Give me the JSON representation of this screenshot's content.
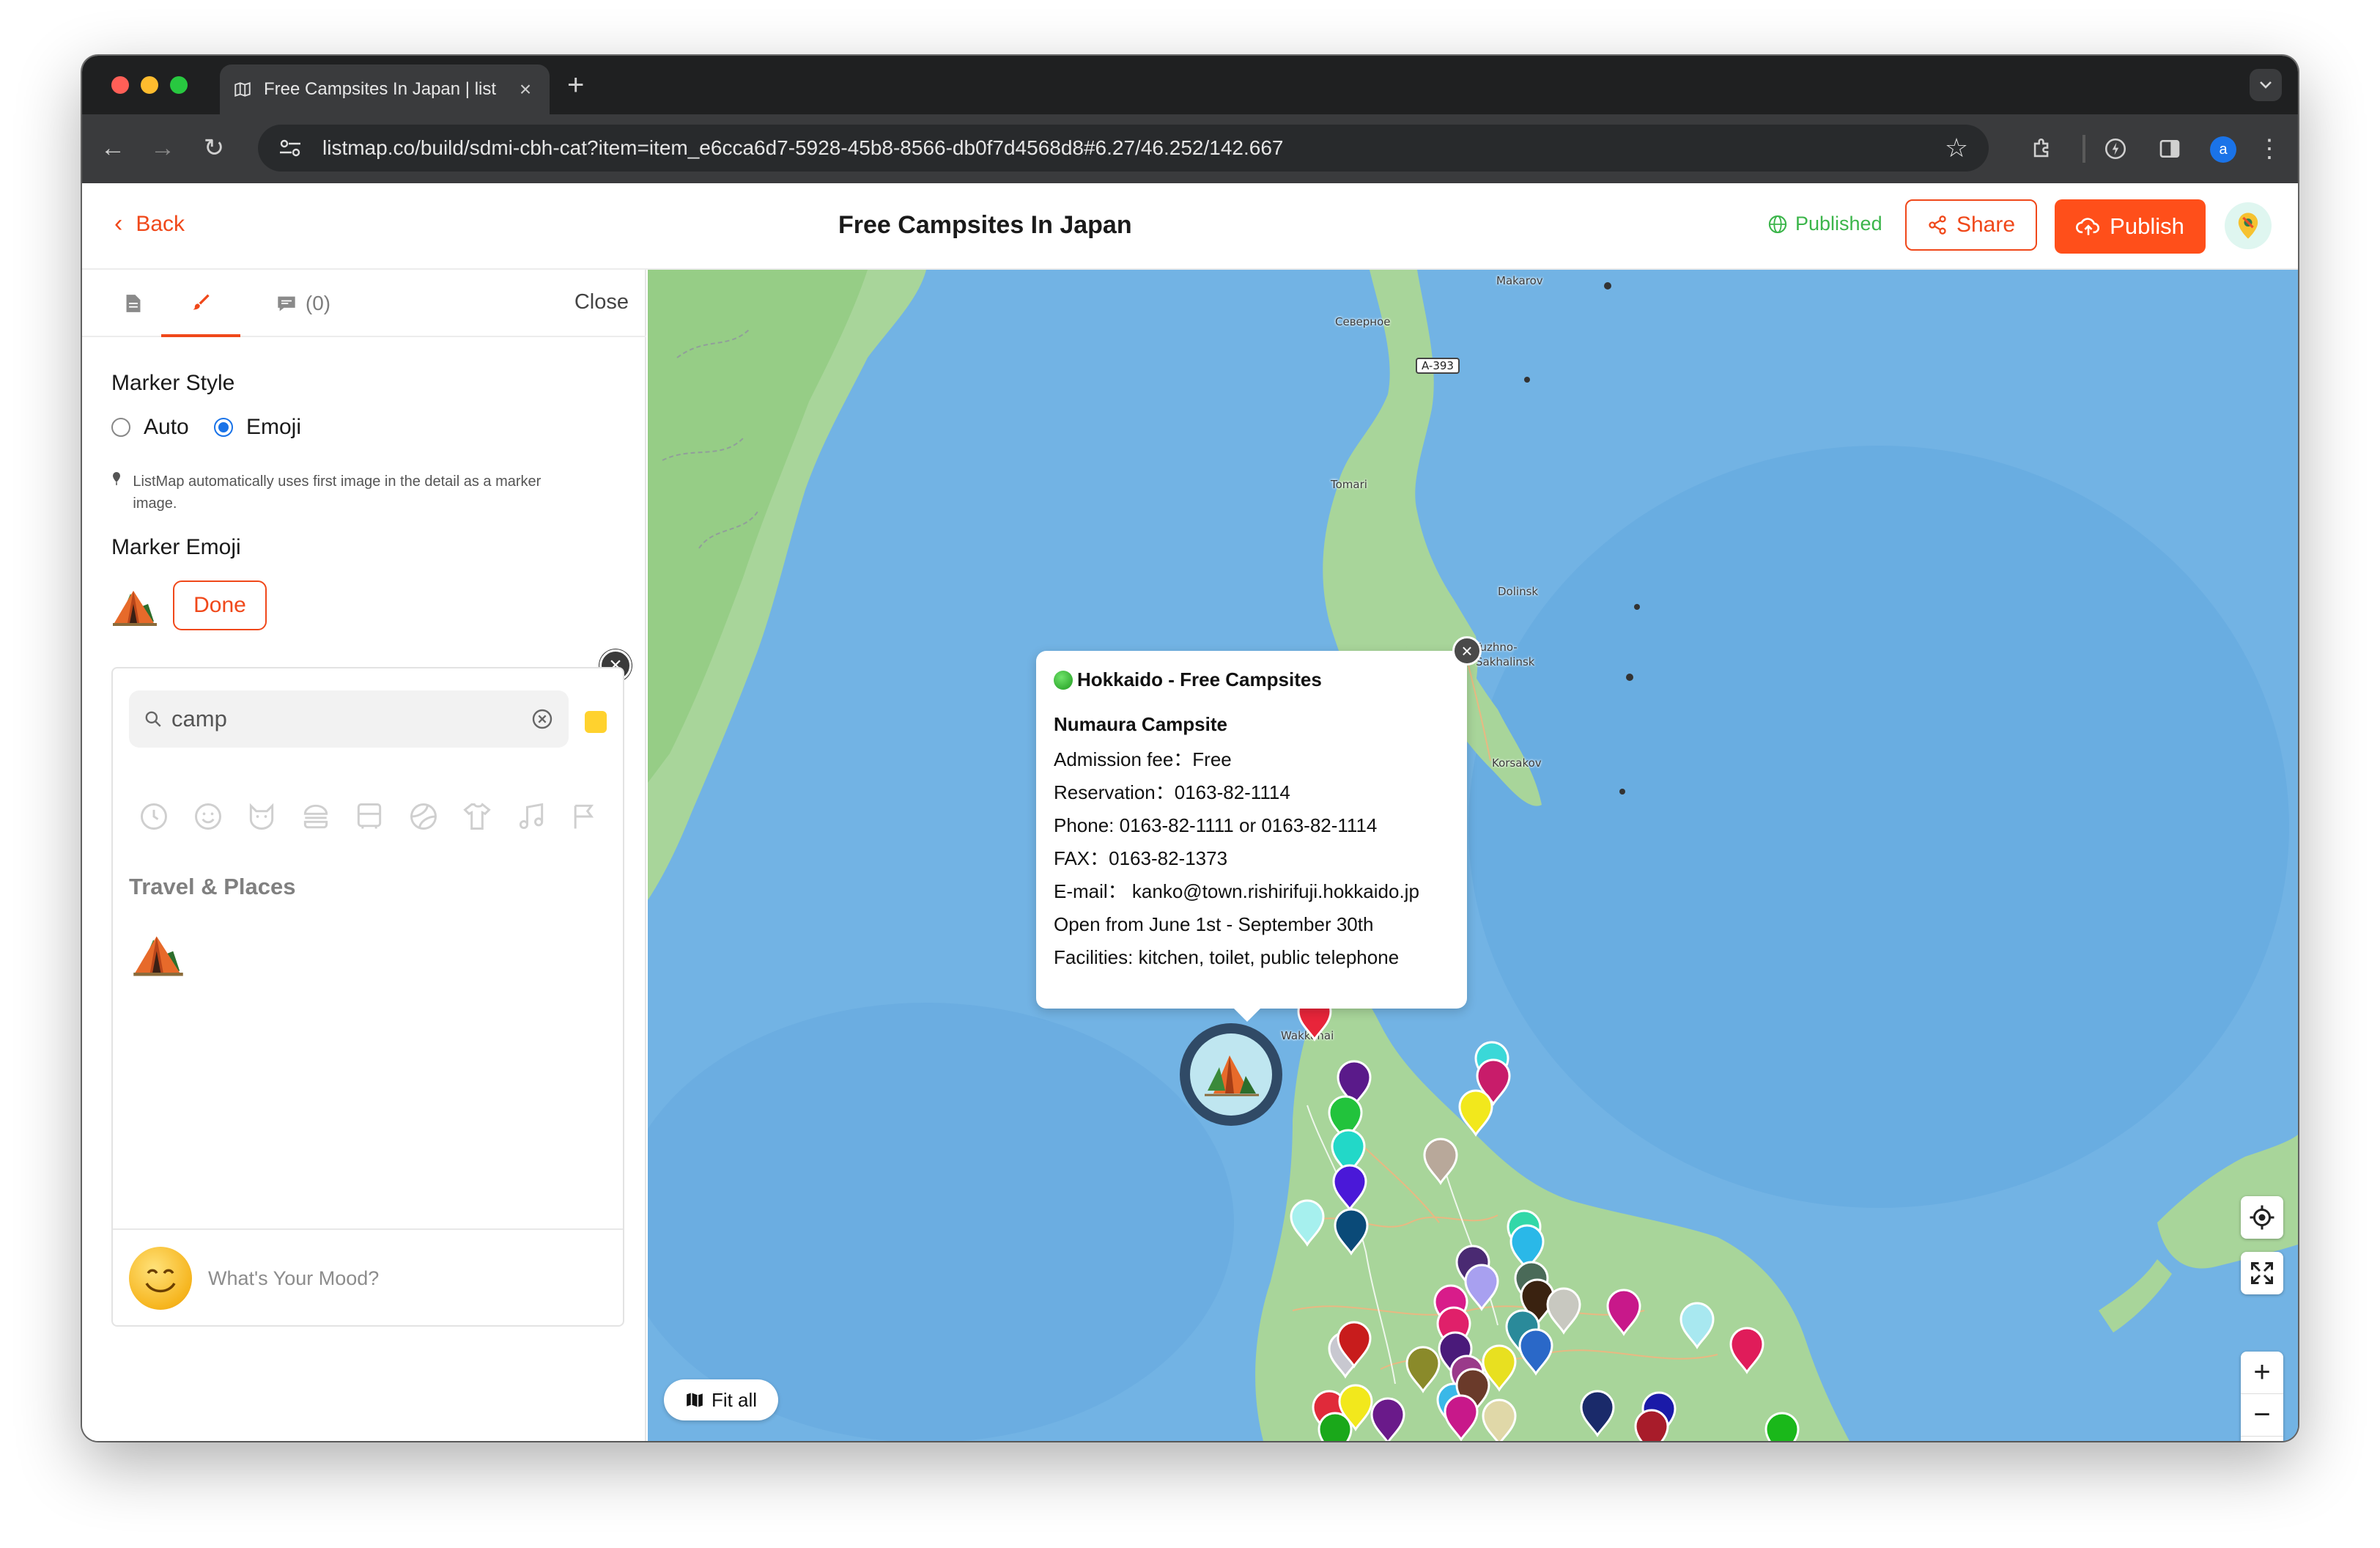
{
  "browser": {
    "tab_title": "Free Campsites In Japan | list",
    "url": "listmap.co/build/sdmi-cbh-cat?item=item_e6cca6d7-5928-45b8-8566-db0f7d4568d8#6.27/46.252/142.667",
    "avatar_letter": "a"
  },
  "header": {
    "back_label": "Back",
    "title": "Free Campsites In Japan",
    "status_label": "Published",
    "share_label": "Share",
    "publish_label": "Publish"
  },
  "sidebar": {
    "tabs": [
      {
        "icon": "document-icon",
        "label": ""
      },
      {
        "icon": "brush-icon",
        "label": ""
      },
      {
        "icon": "comment-icon",
        "label": "(0)"
      }
    ],
    "close_label": "Close",
    "marker_style_title": "Marker Style",
    "marker_style_options": [
      "Auto",
      "Emoji"
    ],
    "marker_style_selected": "Emoji",
    "hint": "ListMap automatically uses first image in the detail as a marker image.",
    "marker_emoji_title": "Marker Emoji",
    "done_label": "Done",
    "picker": {
      "search_value": "camp",
      "categories": [
        "clock-icon",
        "smiley-icon",
        "cat-icon",
        "burger-icon",
        "bus-icon",
        "ball-icon",
        "shirt-icon",
        "music-icon",
        "flag-icon"
      ],
      "category_title": "Travel & Places",
      "results": [
        "tent-emoji"
      ],
      "mood_placeholder": "What's Your Mood?"
    }
  },
  "map": {
    "labels": {
      "makarov": "Makarov",
      "severnoe": "Северное",
      "a393": "A-393",
      "tomari": "Tomari",
      "dolinsk": "Dolinsk",
      "yuzhno": "Yuzhno-",
      "sakhalinsk": "Sakhalinsk",
      "korsakov": "Korsakov",
      "wakkanai": "Wakkanai"
    },
    "popup": {
      "title": "Hokkaido - Free Campsites",
      "name": "Numaura Campsite",
      "lines": [
        "Admission fee：Free",
        "Reservation：0163-82-1114",
        "Phone: 0163-82-1111 or 0163-82-1114",
        "FAX：0163-82-1373",
        "E-mail： kanko@town.rishirifuji.hokkaido.jp",
        "Open from June 1st - September 30th",
        "Facilities: kitchen, toilet, public telephone"
      ]
    },
    "fit_all_label": "Fit all",
    "zoom_in": "+",
    "zoom_out": "−"
  }
}
